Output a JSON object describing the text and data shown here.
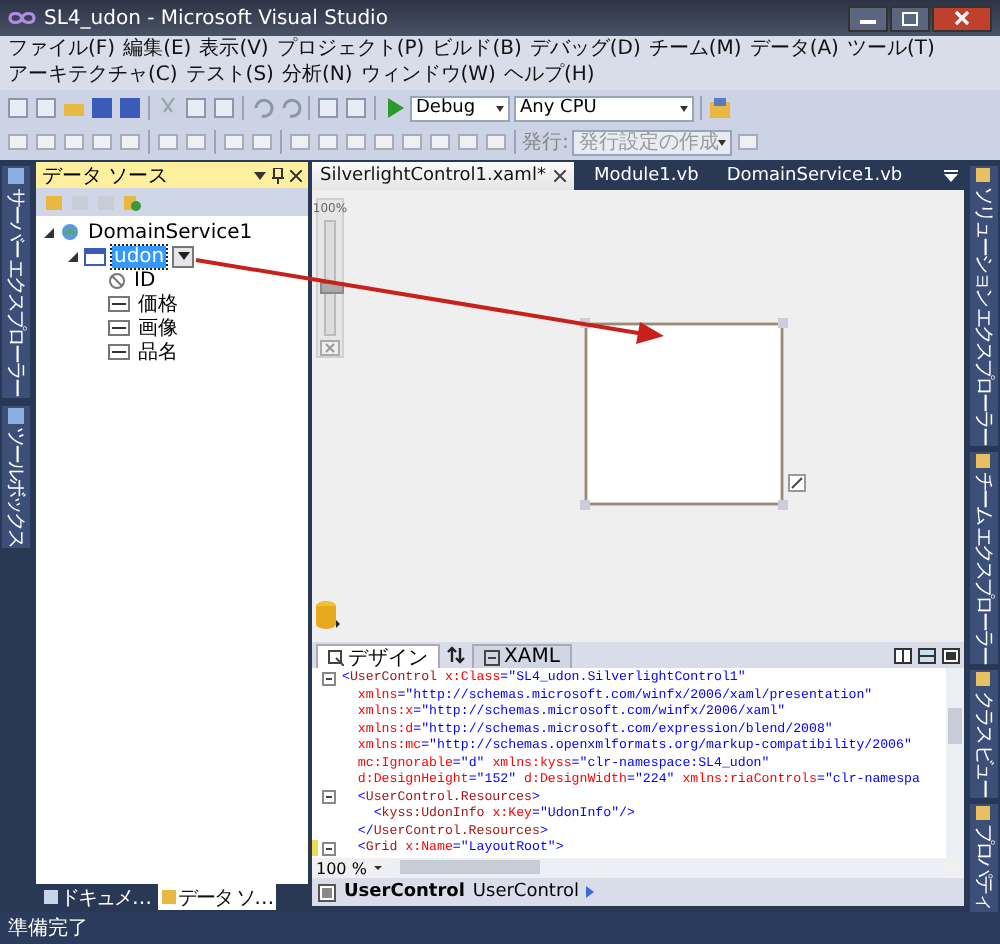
{
  "window": {
    "title": "SL4_udon - Microsoft Visual Studio"
  },
  "menu": [
    "ファイル(F)",
    "編集(E)",
    "表示(V)",
    "プロジェクト(P)",
    "ビルド(B)",
    "デバッグ(D)",
    "チーム(M)",
    "データ(A)",
    "ツール(T)",
    "アーキテクチャ(C)",
    "テスト(S)",
    "分析(N)",
    "ウィンドウ(W)",
    "ヘルプ(H)"
  ],
  "toolbar": {
    "configuration": "Debug",
    "platform": "Any CPU",
    "publish_label": "発行:",
    "publish_profile": "発行設定の作成"
  },
  "left_dock": [
    {
      "label": "サーバー エクスプローラー"
    },
    {
      "label": "ツールボックス"
    }
  ],
  "data_sources": {
    "title": "データ ソース",
    "tree": [
      {
        "label": "DomainService1",
        "kind": "service",
        "expanded": true,
        "selected": false,
        "children": [
          {
            "label": "udon",
            "kind": "entity",
            "expanded": true,
            "selected": true,
            "children": [
              {
                "label": "ID",
                "kind": "id",
                "selected": false
              },
              {
                "label": "価格",
                "kind": "field",
                "selected": false
              },
              {
                "label": "画像",
                "kind": "field",
                "selected": false
              },
              {
                "label": "品名",
                "kind": "field",
                "selected": false
              }
            ]
          }
        ]
      }
    ]
  },
  "bottom_tabs": [
    {
      "label": "ドキュメ…",
      "selected": false
    },
    {
      "label": "データ ソ…",
      "selected": true
    }
  ],
  "editor_tabs": [
    {
      "label": "SilverlightControl1.xaml*",
      "selected": true
    },
    {
      "label": "Module1.vb",
      "selected": false
    },
    {
      "label": "DomainService1.vb",
      "selected": false
    }
  ],
  "designer": {
    "zoom_label": "100%",
    "level": 0.35
  },
  "split_tabs": [
    {
      "label": "デザイン",
      "kind": "design",
      "selected": true
    },
    {
      "label": "XAML",
      "kind": "xaml",
      "selected": false
    }
  ],
  "xaml": [
    {
      "fold": true,
      "changed": false,
      "tokens": [
        {
          "kind": "bracket",
          "text": "<"
        },
        {
          "kind": "tag",
          "text": "UserControl"
        },
        {
          "kind": "attr",
          "text": " x:Class"
        },
        {
          "kind": "bracket",
          "text": "="
        },
        {
          "kind": "value",
          "text": "\"SL4_udon.SilverlightControl1\""
        }
      ]
    },
    {
      "fold": false,
      "changed": false,
      "tokens": [
        {
          "kind": "attr",
          "text": "  xmlns"
        },
        {
          "kind": "bracket",
          "text": "="
        },
        {
          "kind": "value",
          "text": "\"http://schemas.microsoft.com/winfx/2006/xaml/presentation\""
        }
      ]
    },
    {
      "fold": false,
      "changed": false,
      "tokens": [
        {
          "kind": "attr",
          "text": "  xmlns:x"
        },
        {
          "kind": "bracket",
          "text": "="
        },
        {
          "kind": "value",
          "text": "\"http://schemas.microsoft.com/winfx/2006/xaml\""
        }
      ]
    },
    {
      "fold": false,
      "changed": false,
      "tokens": [
        {
          "kind": "attr",
          "text": "  xmlns:d"
        },
        {
          "kind": "bracket",
          "text": "="
        },
        {
          "kind": "value",
          "text": "\"http://schemas.microsoft.com/expression/blend/2008\""
        }
      ]
    },
    {
      "fold": false,
      "changed": false,
      "tokens": [
        {
          "kind": "attr",
          "text": "  xmlns:mc"
        },
        {
          "kind": "bracket",
          "text": "="
        },
        {
          "kind": "value",
          "text": "\"http://schemas.openxmlformats.org/markup-compatibility/2006\""
        }
      ]
    },
    {
      "fold": false,
      "changed": false,
      "tokens": [
        {
          "kind": "attr",
          "text": "  mc:Ignorable"
        },
        {
          "kind": "bracket",
          "text": "="
        },
        {
          "kind": "value",
          "text": "\"d\""
        },
        {
          "kind": "attr",
          "text": " xmlns:kyss"
        },
        {
          "kind": "bracket",
          "text": "="
        },
        {
          "kind": "value",
          "text": "\"clr-namespace:SL4_udon\""
        }
      ]
    },
    {
      "fold": false,
      "changed": false,
      "tokens": [
        {
          "kind": "attr",
          "text": "  d:DesignHeight"
        },
        {
          "kind": "bracket",
          "text": "="
        },
        {
          "kind": "value",
          "text": "\"152\""
        },
        {
          "kind": "attr",
          "text": " d:DesignWidth"
        },
        {
          "kind": "bracket",
          "text": "="
        },
        {
          "kind": "value",
          "text": "\"224\""
        },
        {
          "kind": "attr",
          "text": " xmlns:riaControls"
        },
        {
          "kind": "bracket",
          "text": "="
        },
        {
          "kind": "value",
          "text": "\"clr-namespa"
        }
      ]
    },
    {
      "fold": true,
      "changed": false,
      "tokens": [
        {
          "kind": "bracket",
          "text": "  <"
        },
        {
          "kind": "tag",
          "text": "UserControl.Resources"
        },
        {
          "kind": "bracket",
          "text": ">"
        }
      ]
    },
    {
      "fold": false,
      "changed": false,
      "tokens": [
        {
          "kind": "bracket",
          "text": "    <"
        },
        {
          "kind": "tag",
          "text": "kyss:UdonInfo"
        },
        {
          "kind": "attr",
          "text": " x:Key"
        },
        {
          "kind": "bracket",
          "text": "="
        },
        {
          "kind": "value",
          "text": "\"UdonInfo\""
        },
        {
          "kind": "bracket",
          "text": "/>"
        }
      ]
    },
    {
      "fold": false,
      "changed": false,
      "tokens": [
        {
          "kind": "bracket",
          "text": "  </"
        },
        {
          "kind": "tag",
          "text": "UserControl.Resources"
        },
        {
          "kind": "bracket",
          "text": ">"
        }
      ]
    },
    {
      "fold": true,
      "changed": true,
      "tokens": [
        {
          "kind": "bracket",
          "text": "  <"
        },
        {
          "kind": "tag",
          "text": "Grid"
        },
        {
          "kind": "attr",
          "text": " x:Name"
        },
        {
          "kind": "bracket",
          "text": "="
        },
        {
          "kind": "value",
          "text": "\"LayoutRoot\""
        },
        {
          "kind": "bracket",
          "text": ">"
        }
      ]
    }
  ],
  "code_zoom": "100 %",
  "breadcrumb": [
    {
      "label": "UserControl",
      "selected": true
    },
    {
      "label": "UserControl",
      "selected": false
    }
  ],
  "right_dock": [
    {
      "label": "ソリューション エクスプローラー"
    },
    {
      "label": "チーム エクスプローラー"
    },
    {
      "label": "クラス ビュー"
    },
    {
      "label": "プロパティ"
    }
  ],
  "status_bar": "準備完了"
}
